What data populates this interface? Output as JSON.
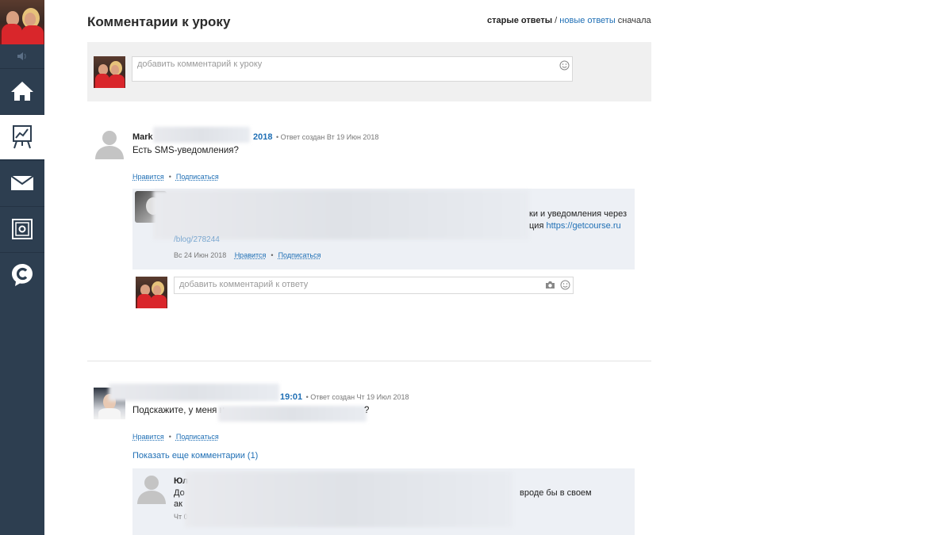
{
  "page": {
    "title": "Комментарии к уроку",
    "sort": {
      "old": "старые ответы",
      "sep": " / ",
      "new": "новые ответы",
      "suffix": " сначала"
    }
  },
  "new_comment": {
    "placeholder": "добавить комментарий к уроку"
  },
  "comments": [
    {
      "author": "Mark",
      "date_link": "2018",
      "meta": "• Ответ создан Вт 19 Июн 2018",
      "text": "Есть SMS-уведомления?",
      "like": "Нравится",
      "subscribe": "Подписаться",
      "reply": {
        "text_line1_end": "ки и уведомления через",
        "text_line2_end": "ция",
        "link": "https://getcourse.ru",
        "link2": "/blog/278244",
        "date": "Вс 24 Июн 2018",
        "like": "Нравится",
        "subscribe": "Подписаться"
      },
      "reply_input_placeholder": "добавить комментарий к ответу"
    },
    {
      "date_link": "19:01",
      "meta": "• Ответ создан Чт 19 Июл 2018",
      "text_start": "Подскажите, у меня н",
      "text_end": "?",
      "like": "Нравится",
      "subscribe": "Подписаться",
      "show_more": "Показать еще комментарии (1)",
      "reply": {
        "author": "Юл",
        "author_end": "И",
        "line1_start": "До",
        "line1_end": "вроде бы в своем",
        "line2_start": "ак",
        "line3_start": "Чт 0"
      }
    }
  ],
  "colors": {
    "sidebar": "#2d3e50",
    "link": "#1f6fb5",
    "panel": "#f0f0f0",
    "reply_panel": "#edf0f5"
  }
}
